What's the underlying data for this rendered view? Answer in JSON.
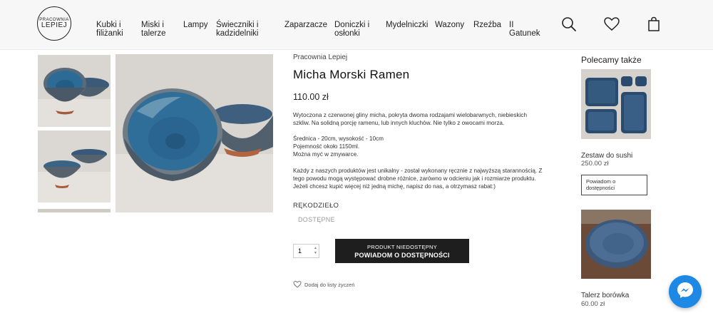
{
  "logo": {
    "line1": "PRACOWNIA",
    "line2": "LEPIEJ"
  },
  "nav": [
    {
      "line1": "Kubki i",
      "line2": "filiżanki"
    },
    {
      "line1": "Miski i",
      "line2": "talerze"
    },
    {
      "line1": "Lampy",
      "line2": ""
    },
    {
      "line1": "Świeczniki i",
      "line2": "kadzidelniki"
    },
    {
      "line1": "Zaparzacze",
      "line2": ""
    },
    {
      "line1": "Doniczki i",
      "line2": "osłonki"
    },
    {
      "line1": "Mydelniczki",
      "line2": ""
    },
    {
      "line1": "Wazony",
      "line2": ""
    },
    {
      "line1": "Rzeźba",
      "line2": ""
    },
    {
      "line1": "II",
      "line2": "Gatunek"
    }
  ],
  "header_icons": [
    "search-icon",
    "heart-icon",
    "bag-icon"
  ],
  "product": {
    "brand": "Pracownia Lepiej",
    "title": "Micha Morski Ramen",
    "price": "110.00 zł",
    "description": [
      "Wytoczona z czerwonej gliny micha, pokryta dwoma rodzajami wielobarwnych, niebieskich",
      "szkliw. Na solidną porcję ramenu, lub innych kluchów. Nie tylko z owocami morza."
    ],
    "specs": [
      "Średnica - 20cm, wysokość - 10cm",
      "Pojemność około 1150ml.",
      "Można myć w zmywarce."
    ],
    "note": [
      "Każdy z naszych produktów jest unikalny - został wykonany ręcznie z najwyższą starannością. Z",
      "tego powodu mogą występować drobne różnice, zarówno w odcieniu jak i rozmiarze produktu.",
      "Jeżeli chcesz kupić więcej niż jedną michę, napisz do nas, a otrzymasz rabat:)"
    ],
    "category": "RĘKODZIEŁO",
    "availability": "DOSTĘPNE",
    "quantity": "1",
    "notify_button": {
      "line1": "PRODUKT NIEDOSTĘPNY",
      "line2": "POWIADOM O DOSTĘPNOŚCI"
    },
    "wishlist_label": "Dodaj do listy życzeń"
  },
  "recommended": {
    "title": "Polecamy także",
    "items": [
      {
        "name": "Zestaw do sushi",
        "price": "250.00 zł",
        "notify_line1": "Powiadom o",
        "notify_line2": "dostępności"
      },
      {
        "name": "Talerz borówka",
        "price": "60.00 zł"
      }
    ]
  },
  "colors": {
    "glaze_blue": "#2f6e99",
    "header_bg": "#f7f7f7",
    "button_dark": "#1e1e1e",
    "messenger_blue": "#1e88e5"
  }
}
